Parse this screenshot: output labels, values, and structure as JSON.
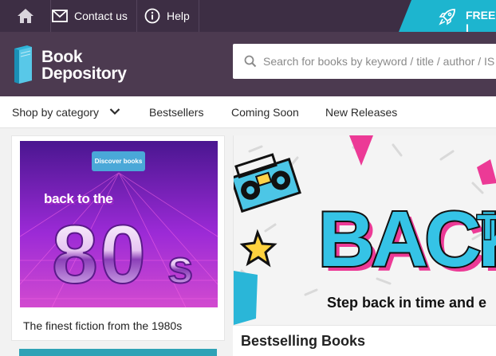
{
  "topbar": {
    "contact_label": "Contact us",
    "help_label": "Help",
    "free_delivery_label": "FREE I",
    "icons": [
      "home-icon",
      "envelope-icon",
      "info-icon",
      "rocket-icon"
    ]
  },
  "header": {
    "logo_line1": "Book",
    "logo_line2": "Depository",
    "search_placeholder": "Search for books by keyword / title / author / IS"
  },
  "nav": {
    "items": [
      {
        "label": "Shop by category",
        "has_dropdown": true
      },
      {
        "label": "Bestsellers"
      },
      {
        "label": "Coming Soon"
      },
      {
        "label": "New Releases"
      }
    ]
  },
  "promo_card": {
    "button_label": "Discover books",
    "artwork_text": "back to the",
    "artwork_big": "80s",
    "caption": "The finest fiction from the 1980s"
  },
  "hero": {
    "headline": "BACK",
    "headline_suffix": "TO",
    "tagline": "Step back in time and e"
  },
  "sections": {
    "bestselling_title": "Bestselling Books"
  },
  "colors": {
    "topbar": "#3d2e44",
    "header": "#4c3a50",
    "accent_teal": "#1db5cf",
    "promo_purple": "#8a1fc8",
    "promo_pink": "#e040c8"
  }
}
